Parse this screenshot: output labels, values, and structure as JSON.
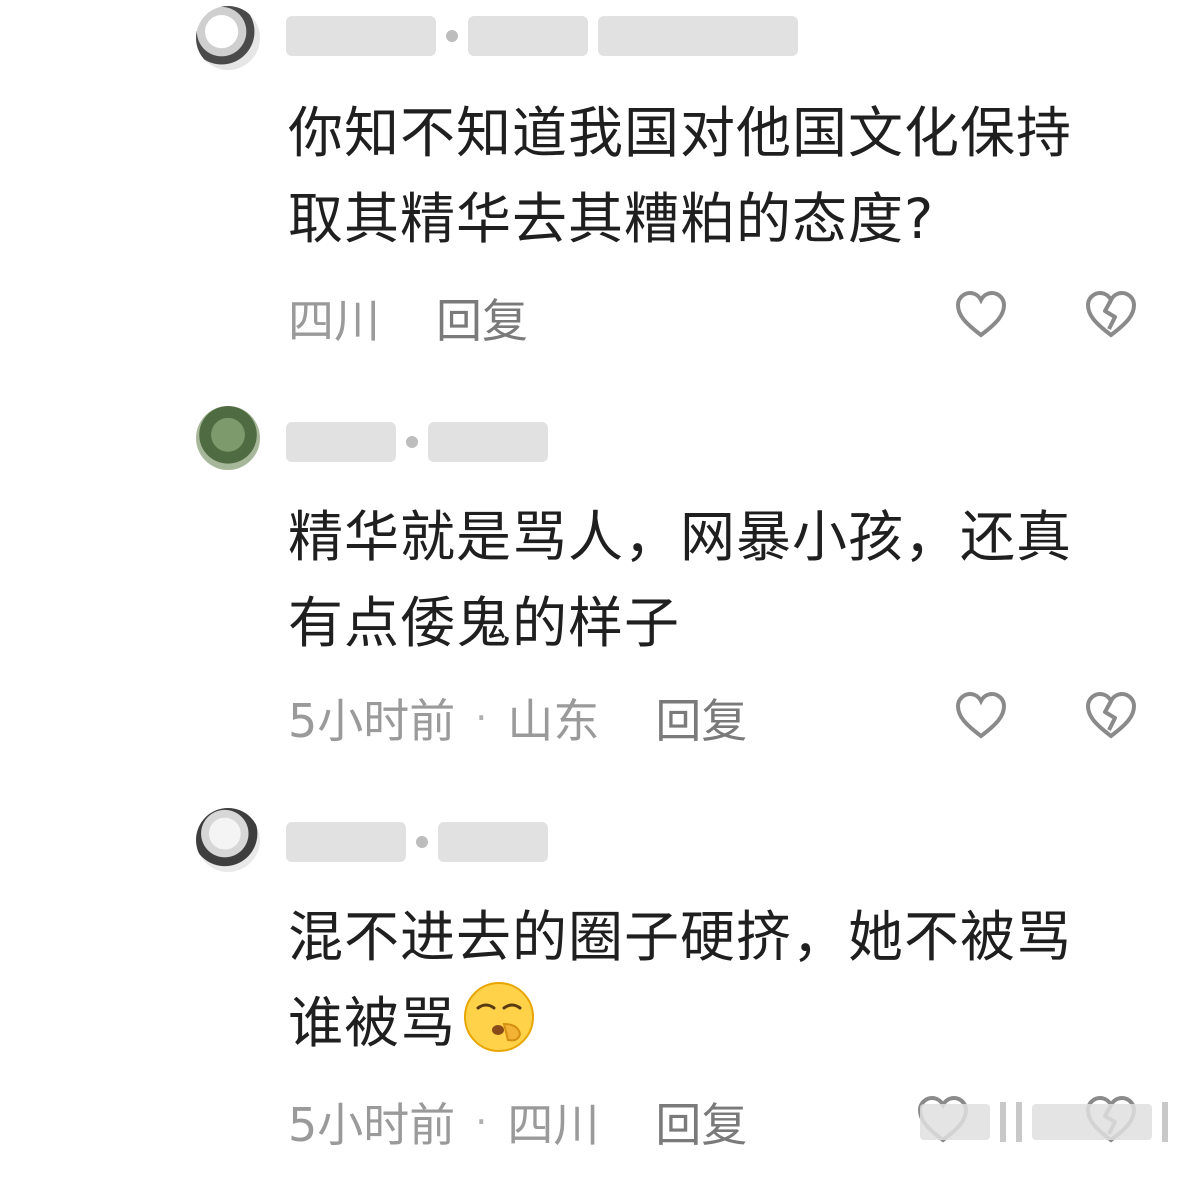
{
  "comments": [
    {
      "text": "你知不知道我国对他国文化保持取其精华去其糟粕的态度?",
      "location": "四川",
      "time": "",
      "reply_label": "回复"
    },
    {
      "text": "精华就是骂人，网暴小孩，还真有点倭鬼的样子",
      "location": "山东",
      "time": "5小时前",
      "reply_label": "回复"
    },
    {
      "text": "混不进去的圈子硬挤，她不被骂谁被骂",
      "location": "四川",
      "time": "5小时前",
      "reply_label": "回复"
    }
  ],
  "icons": {
    "like": "heart-outline-icon",
    "dislike": "broken-heart-icon",
    "emoji": "shushing-face-emoji-icon"
  },
  "colors": {
    "text": "#1f1f1f",
    "meta": "#9a9a9a",
    "reply": "#7a7a7a",
    "icon": "#8a8a8a"
  }
}
